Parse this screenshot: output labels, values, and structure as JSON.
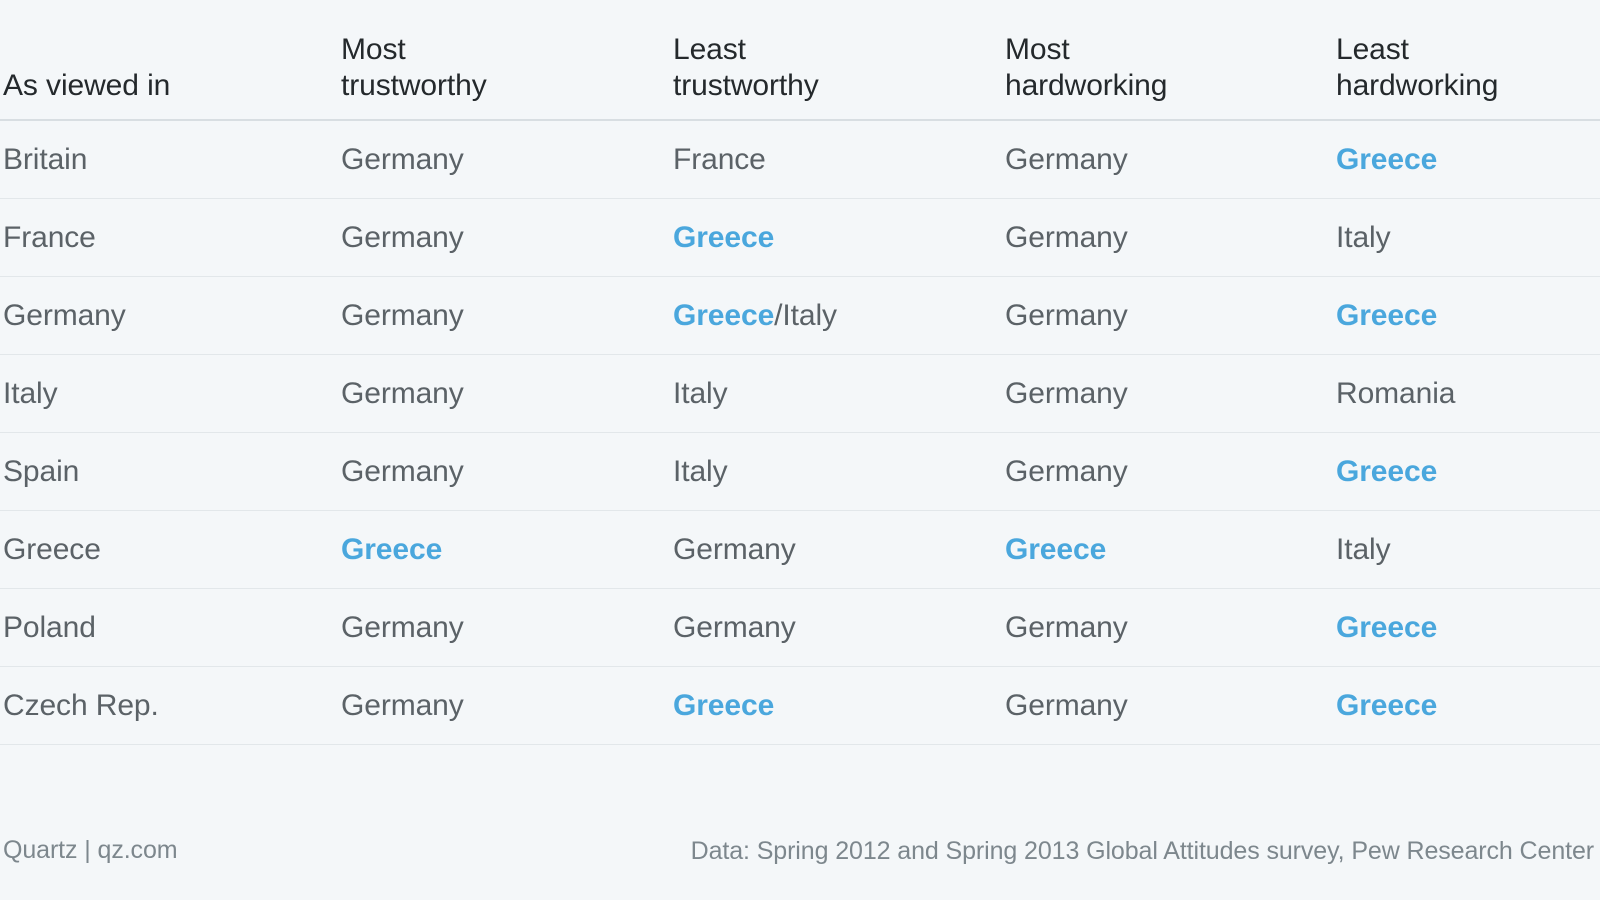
{
  "chart_data": {
    "type": "table",
    "title": "",
    "columns": [
      "As viewed in",
      "Most trustworthy",
      "Least trustworthy",
      "Most hardworking",
      "Least hardworking"
    ],
    "column_lines": [
      {
        "l1": "",
        "l2": "As viewed in"
      },
      {
        "l1": "Most",
        "l2": "trustworthy"
      },
      {
        "l1": "Least",
        "l2": "trustworthy"
      },
      {
        "l1": "Most",
        "l2": "hardworking"
      },
      {
        "l1": "Least",
        "l2": "hardworking"
      }
    ],
    "highlight_color": "#4aa7dd",
    "highlight_term": "Greece",
    "rows": [
      {
        "country": "Britain",
        "most_trustworthy": "Germany",
        "least_trustworthy": "France",
        "most_hardworking": "Germany",
        "least_hardworking": "Greece"
      },
      {
        "country": "France",
        "most_trustworthy": "Germany",
        "least_trustworthy": "Greece",
        "most_hardworking": "Germany",
        "least_hardworking": "Italy"
      },
      {
        "country": "Germany",
        "most_trustworthy": "Germany",
        "least_trustworthy": "Greece/Italy",
        "most_hardworking": "Germany",
        "least_hardworking": "Greece"
      },
      {
        "country": "Italy",
        "most_trustworthy": "Germany",
        "least_trustworthy": "Italy",
        "most_hardworking": "Germany",
        "least_hardworking": "Romania"
      },
      {
        "country": "Spain",
        "most_trustworthy": "Germany",
        "least_trustworthy": "Italy",
        "most_hardworking": "Germany",
        "least_hardworking": "Greece"
      },
      {
        "country": "Greece",
        "most_trustworthy": "Greece",
        "least_trustworthy": "Germany",
        "most_hardworking": "Greece",
        "least_hardworking": "Italy"
      },
      {
        "country": "Poland",
        "most_trustworthy": "Germany",
        "least_trustworthy": "Germany",
        "most_hardworking": "Germany",
        "least_hardworking": "Greece"
      },
      {
        "country": "Czech Rep.",
        "most_trustworthy": "Germany",
        "least_trustworthy": "Greece",
        "most_hardworking": "Germany",
        "least_hardworking": "Greece"
      }
    ]
  },
  "header": {
    "col1_line1": "",
    "col1_line2": "As viewed in",
    "col2_line1": "Most",
    "col2_line2": "trustworthy",
    "col3_line1": "Least",
    "col3_line2": "trustworthy",
    "col4_line1": "Most",
    "col4_line2": "hardworking",
    "col5_line1": "Least",
    "col5_line2": "hardworking"
  },
  "footer": {
    "credit": "Quartz | qz.com",
    "source": "Data: Spring 2012 and Spring 2013 Global Attitudes survey, Pew Research Center"
  },
  "colors": {
    "background": "#f4f7f9",
    "header_text": "#24292c",
    "body_text": "#5b6267",
    "footer_text": "#7d878d",
    "rule": "#e2e7ea",
    "header_rule": "#d8dee2",
    "accent": "#4aa7dd"
  }
}
